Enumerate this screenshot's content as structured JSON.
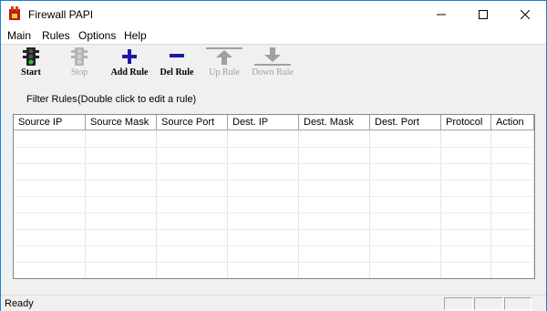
{
  "window": {
    "title": "Firewall PAPI"
  },
  "menu": [
    "Main",
    "Rules",
    "Options",
    "Help"
  ],
  "toolbar": {
    "start": {
      "label": "Start",
      "enabled": true
    },
    "stop": {
      "label": "Stop",
      "enabled": false
    },
    "add_rule": {
      "label": "Add Rule",
      "enabled": true
    },
    "del_rule": {
      "label": "Del Rule",
      "enabled": true
    },
    "up_rule": {
      "label": "Up Rule",
      "enabled": false
    },
    "down_rule": {
      "label": "Down Rule",
      "enabled": false
    }
  },
  "filter_rules": {
    "label": "Filter Rules",
    "hint": "(Double click to edit a rule)",
    "columns": [
      "Source IP",
      "Source Mask",
      "Source Port",
      "Dest. IP",
      "Dest. Mask",
      "Dest. Port",
      "Protocol",
      "Action"
    ],
    "rows": []
  },
  "status": {
    "text": "Ready"
  },
  "colors": {
    "accent_blue": "#1a1aa6",
    "disabled_gray": "#a0a0a0",
    "window_border": "#1883d7"
  }
}
